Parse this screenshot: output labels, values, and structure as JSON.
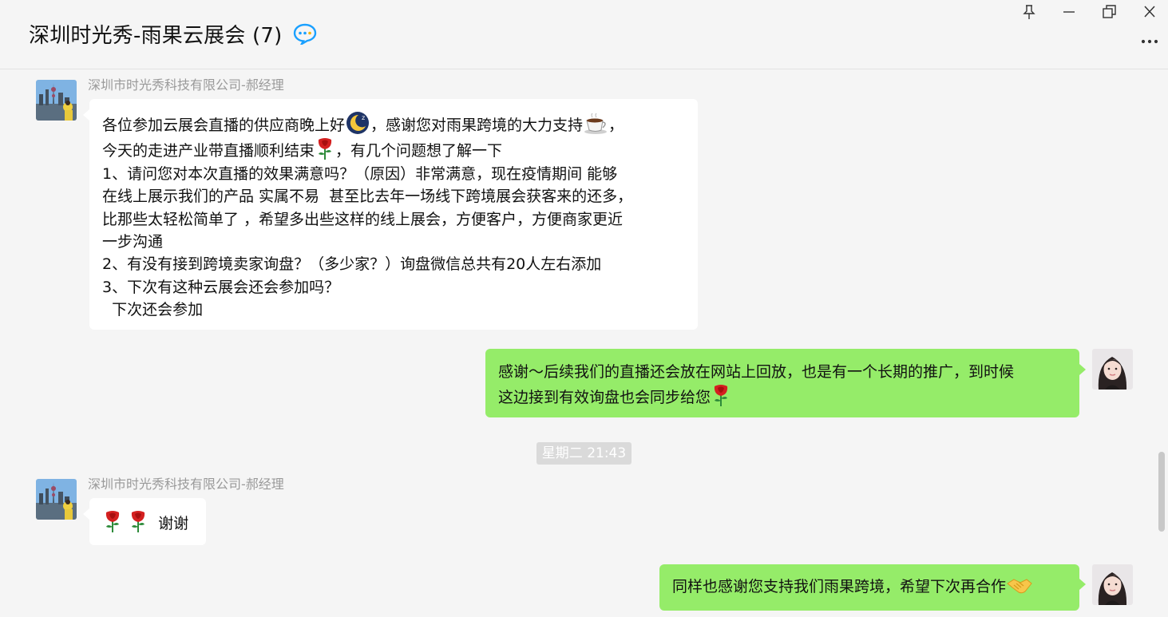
{
  "window": {
    "title": "深圳时光秀-雨果云展会 (7)",
    "title_icon": "chat-bubble-icon",
    "controls": [
      "pin-icon",
      "minimize-icon",
      "restore-icon",
      "close-icon"
    ],
    "more_icon": "more-dots-icon"
  },
  "messages": [
    {
      "side": "left",
      "sender": "深圳市时光秀科技有限公司-郝经理",
      "avatar": "avatar-cityscape-icon",
      "lines": [
        {
          "text": "各位参加云展会直播的供应商晚上好",
          "emoji1": "sleeping-moon-emoji",
          "text2": "，感谢您对雨果跨境的大力支持",
          "emoji2": "hot-beverage-emoji",
          "text3": "，"
        },
        {
          "text": "今天的走进产业带直播顺利结束",
          "emoji1": "rose-emoji",
          "text2": "，有几个问题想了解一下"
        },
        {
          "text": "1、请问您对本次直播的效果满意吗？（原因）非常满意，现在疫情期间 能够"
        },
        {
          "text": "在线上展示我们的产品 实属不易  甚至比去年一场线下跨境展会获客来的还多，"
        },
        {
          "text": "比那些太轻松简单了 ，希望多出些这样的线上展会，方便客户，方便商家更近"
        },
        {
          "text": "一步沟通"
        },
        {
          "text": "2、有没有接到跨境卖家询盘？（多少家？）询盘微信总共有20人左右添加"
        },
        {
          "text": "3、下次有这种云展会还会参加吗？"
        },
        {
          "text": "  下次还会参加"
        }
      ]
    },
    {
      "side": "right",
      "avatar": "avatar-woman-icon",
      "lines": [
        {
          "text": "感谢～后续我们的直播还会放在网站上回放，也是有一个长期的推广，到时候"
        },
        {
          "text": "这边接到有效询盘也会同步给您",
          "emoji1": "rose-emoji"
        }
      ]
    },
    {
      "type": "timestamp",
      "text": "星期二 21:43"
    },
    {
      "side": "left",
      "sender": "深圳市时光秀科技有限公司-郝经理",
      "avatar": "avatar-cityscape-icon",
      "lines": [
        {
          "emoji1": "rose-emoji",
          "emoji2": "rose-emoji",
          "text": "谢谢"
        }
      ]
    },
    {
      "side": "right",
      "avatar": "avatar-woman-icon",
      "lines": [
        {
          "text": "同样也感谢您支持我们雨果跨境，希望下次再合作",
          "emoji1": "handshake-emoji"
        }
      ]
    }
  ],
  "colors": {
    "background": "#f5f5f5",
    "incoming_bubble": "#ffffff",
    "outgoing_bubble": "#95ec69",
    "sender_name": "#9a9a9a",
    "timestamp_bg": "#dadada"
  }
}
